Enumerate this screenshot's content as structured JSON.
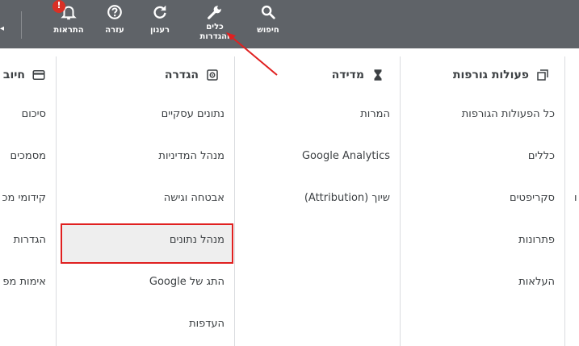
{
  "toolbar": {
    "buttons": [
      {
        "id": "search",
        "label": "חיפוש",
        "icon": "search-icon"
      },
      {
        "id": "tools",
        "label": "כלים והגדרות",
        "label_line1": "כלים",
        "label_line2": "והגדרות",
        "icon": "wrench-icon"
      },
      {
        "id": "refresh",
        "label": "רענון",
        "icon": "refresh-icon"
      },
      {
        "id": "help",
        "label": "עזרה",
        "icon": "help-icon"
      },
      {
        "id": "notifications",
        "label": "התראות",
        "icon": "bell-icon",
        "badge": "!"
      }
    ]
  },
  "menu": {
    "columns": [
      {
        "title": "פעולות גורפות",
        "icon": "bulk-actions-icon",
        "items": [
          "כל הפעולות הגורפות",
          "כללים",
          "סקריפטים",
          "פתרונות",
          "העלאות"
        ]
      },
      {
        "title": "מדידה",
        "icon": "hourglass-icon",
        "items": [
          "המרות",
          "Google Analytics",
          "שיוך (Attribution)"
        ]
      },
      {
        "title": "הגדרה",
        "icon": "setup-icon",
        "items": [
          "נתונים עסקיים",
          "מנהל המדיניות",
          "אבטחה וגישה",
          "מנהל נתונים",
          "התג של Google",
          "העדפות"
        ],
        "highlighted_item": "מנהל נתונים"
      },
      {
        "title": "חיוב",
        "icon": "credit-card-icon",
        "items": [
          "סיכום",
          "מסמכים",
          "קידומי מכ",
          "הגדרות",
          "אימות מפ"
        ]
      }
    ]
  },
  "colors": {
    "toolbar_bg": "#5f6368",
    "highlight_border": "#e02020",
    "highlight_bg": "#eeeeee",
    "arrow": "#e02020"
  }
}
